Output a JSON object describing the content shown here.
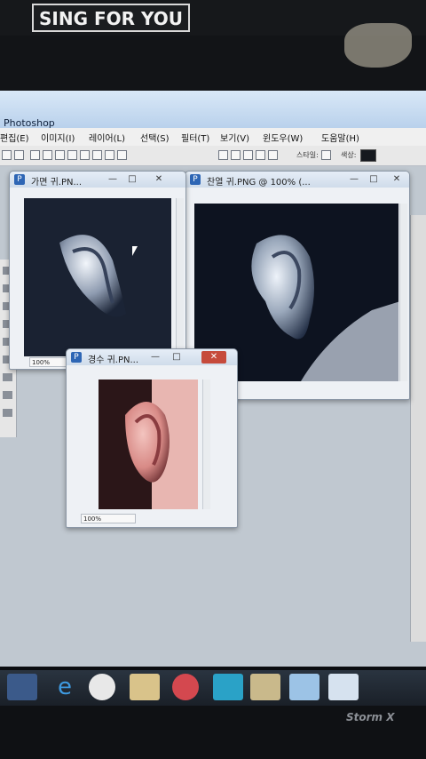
{
  "sticker": {
    "text": "SING FOR YOU"
  },
  "app": {
    "title": "Photoshop"
  },
  "menu": {
    "items": [
      "편집(E)",
      "이미지(I)",
      "레이어(L)",
      "선택(S)",
      "필터(T)",
      "보기(V)",
      "윈도우(W)",
      "도움말(H)"
    ]
  },
  "options_bar": {
    "style_label": "스타일:",
    "color_label": "색상:"
  },
  "windows": {
    "win1": {
      "title": "가면 귀.PN...",
      "zoom": "100%"
    },
    "win2": {
      "title": "찬열 귀.PNG @ 100% (...",
      "zoom": ""
    },
    "win3": {
      "title": "경수 귀.PN...",
      "zoom": "100%"
    }
  },
  "window_controls": {
    "minimize": "—",
    "maximize": "□",
    "close": "✕"
  },
  "taskbar": {
    "caption": "",
    "icons": [
      "media-player-icon",
      "internet-explorer-icon",
      "chrome-icon",
      "file-explorer-icon",
      "power-app-icon",
      "play-app-icon",
      "folder-icon",
      "paint-icon",
      "feather-icon"
    ]
  },
  "monitor": {
    "brand": "Storm X"
  },
  "colors": {
    "title_bar": "#c6daf0",
    "close_button": "#c64a3b",
    "taskbar": "#1f2730"
  }
}
